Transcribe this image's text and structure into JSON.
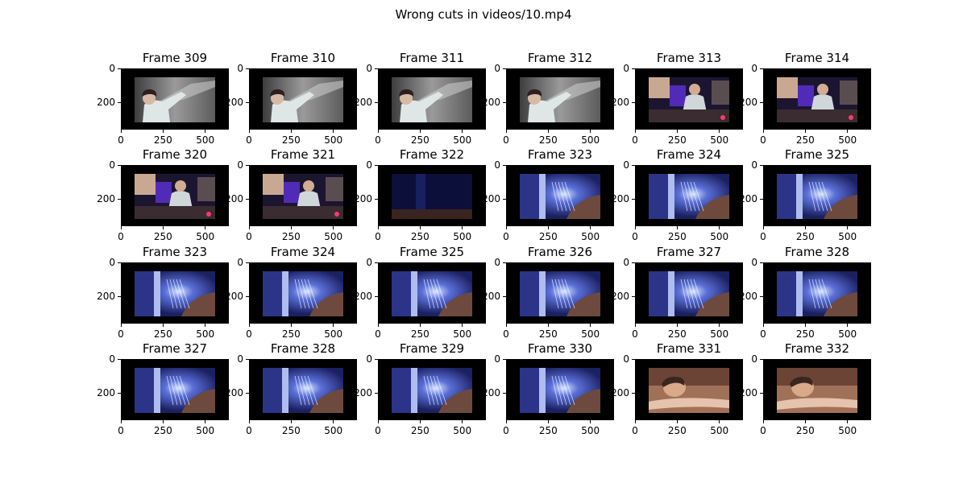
{
  "figure": {
    "title": "Wrong cuts in videos/10.mp4"
  },
  "chart_data": {
    "type": "image-grid",
    "title": "Wrong cuts in videos/10.mp4",
    "rows": 4,
    "cols": 6,
    "image_extent": {
      "x": [
        0,
        640
      ],
      "y": [
        360,
        0
      ]
    },
    "xticks": [
      0,
      250,
      500
    ],
    "xtick_labels": [
      "0",
      "250",
      "500"
    ],
    "yticks": [
      0,
      200
    ],
    "ytick_labels": [
      "0",
      "200"
    ],
    "frames": [
      {
        "title": "Frame 309",
        "scene": "office"
      },
      {
        "title": "Frame 310",
        "scene": "office"
      },
      {
        "title": "Frame 311",
        "scene": "office"
      },
      {
        "title": "Frame 312",
        "scene": "office"
      },
      {
        "title": "Frame 313",
        "scene": "purple-room"
      },
      {
        "title": "Frame 314",
        "scene": "purple-room"
      },
      {
        "title": "Frame 320",
        "scene": "purple-room"
      },
      {
        "title": "Frame 321",
        "scene": "purple-room"
      },
      {
        "title": "Frame 322",
        "scene": "dark-blue"
      },
      {
        "title": "Frame 323",
        "scene": "blue-cables"
      },
      {
        "title": "Frame 324",
        "scene": "blue-cables"
      },
      {
        "title": "Frame 325",
        "scene": "blue-cables"
      },
      {
        "title": "Frame 323",
        "scene": "blue-cables"
      },
      {
        "title": "Frame 324",
        "scene": "blue-cables"
      },
      {
        "title": "Frame 325",
        "scene": "blue-cables"
      },
      {
        "title": "Frame 326",
        "scene": "blue-cables"
      },
      {
        "title": "Frame 327",
        "scene": "blue-cables"
      },
      {
        "title": "Frame 328",
        "scene": "blue-cables"
      },
      {
        "title": "Frame 327",
        "scene": "blue-cables"
      },
      {
        "title": "Frame 328",
        "scene": "blue-cables"
      },
      {
        "title": "Frame 329",
        "scene": "blue-cables"
      },
      {
        "title": "Frame 330",
        "scene": "blue-cables"
      },
      {
        "title": "Frame 331",
        "scene": "warm-sleeping"
      },
      {
        "title": "Frame 332",
        "scene": "warm-sleeping"
      }
    ]
  }
}
